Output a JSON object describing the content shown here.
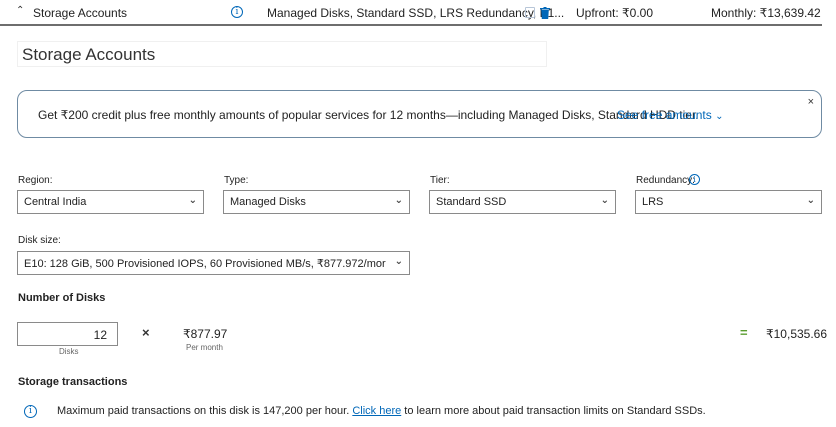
{
  "header": {
    "title": "Storage Accounts",
    "description": "Managed Disks, Standard SSD, LRS Redundancy, E1...",
    "upfront": "Upfront: ₹0.00",
    "monthly": "Monthly: ₹13,639.42"
  },
  "name_field": {
    "value": "Storage Accounts"
  },
  "banner": {
    "text": "Get ₹200 credit plus free monthly amounts of popular services for 12 months—including Managed Disks, Standard HDD tier.",
    "link": "See free amounts",
    "close": "×"
  },
  "region": {
    "label": "Region:",
    "value": "Central India"
  },
  "type": {
    "label": "Type:",
    "value": "Managed Disks"
  },
  "tier": {
    "label": "Tier:",
    "value": "Standard SSD"
  },
  "redundancy": {
    "label": "Redundancy:",
    "value": "LRS"
  },
  "disk_size": {
    "label": "Disk size:",
    "value": "E10: 128 GiB, 500 Provisioned IOPS, 60 Provisioned MB/s, ₹877.972/mor"
  },
  "disks": {
    "heading": "Number of Disks",
    "quantity": "12",
    "quantity_caption": "Disks",
    "operator": "×",
    "unit_price": "₹877.97",
    "unit_caption": "Per month",
    "equals": "=",
    "total": "₹10,535.66"
  },
  "transactions": {
    "heading": "Storage transactions",
    "note_before": "Maximum paid transactions on this disk is 147,200 per hour. ",
    "note_link": "Click here",
    "note_after": " to learn more about paid transaction limits on Standard SSDs."
  },
  "colors": {
    "accent": "#0067b8",
    "equals": "#5a9c2f"
  }
}
